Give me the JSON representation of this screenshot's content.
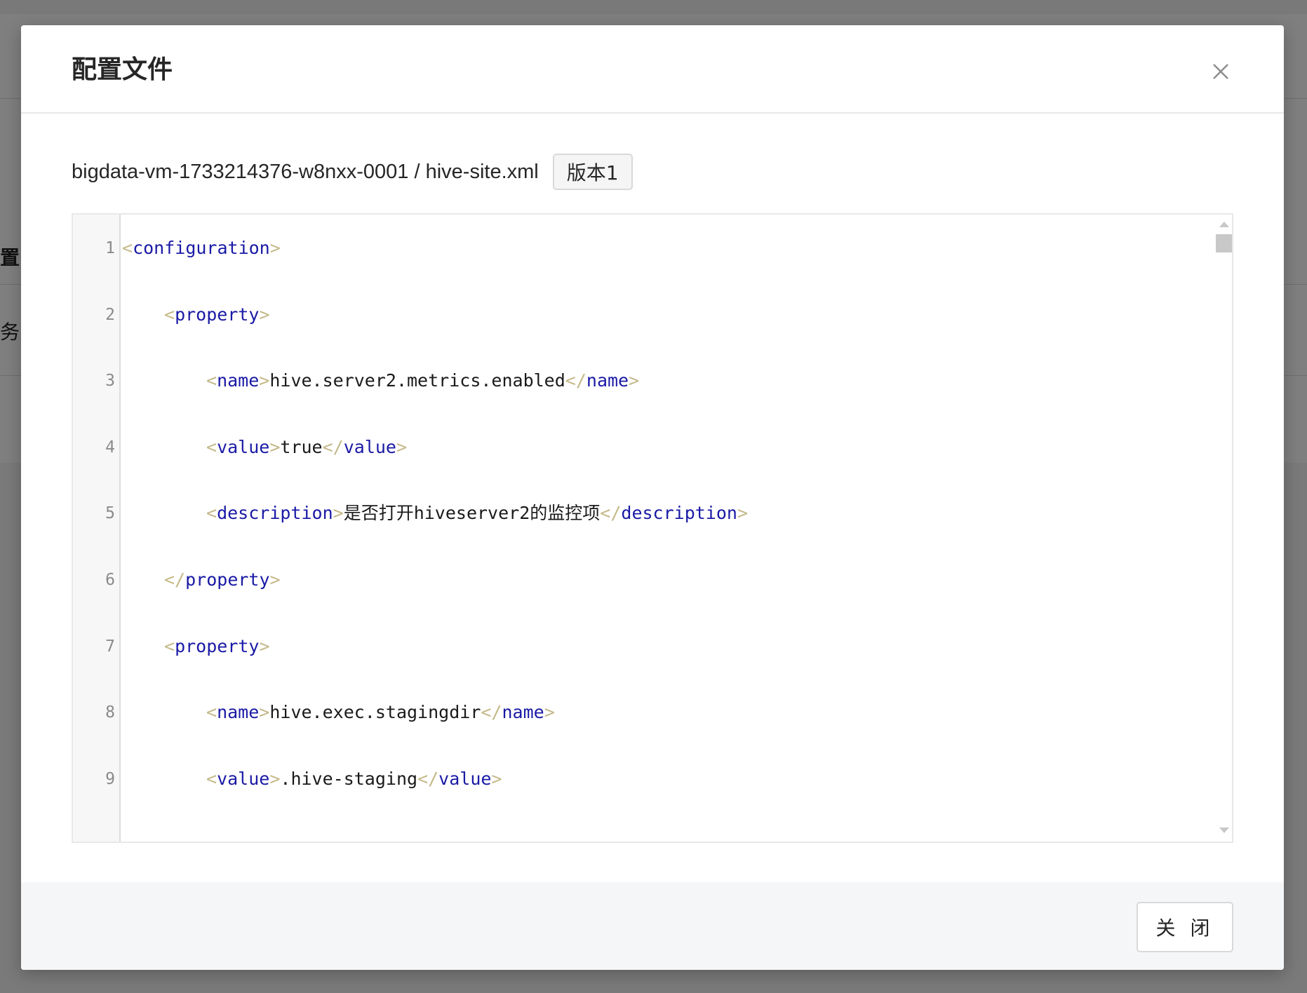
{
  "background": {
    "row1_text": "置",
    "row2_text": "务i"
  },
  "modal": {
    "title": "配置文件",
    "close_icon": "close-icon",
    "file_path": "bigdata-vm-1733214376-w8nxx-0001 / hive-site.xml",
    "version_label": "版本1",
    "footer_button_label": "关 闭"
  },
  "editor": {
    "lines": [
      {
        "number": "1",
        "open": "configuration",
        "text": "",
        "close": ""
      },
      {
        "number": "2",
        "open": "property",
        "text": "",
        "close": ""
      },
      {
        "number": "3",
        "open": "name",
        "text": "hive.server2.metrics.enabled",
        "close": "name"
      },
      {
        "number": "4",
        "open": "value",
        "text": "true",
        "close": "value"
      },
      {
        "number": "5",
        "open": "description",
        "text": "是否打开hiveserver2的监控项",
        "close": "description"
      },
      {
        "number": "6",
        "open": "",
        "text": "",
        "close": "property"
      },
      {
        "number": "7",
        "open": "property",
        "text": "",
        "close": ""
      },
      {
        "number": "8",
        "open": "name",
        "text": "hive.exec.stagingdir",
        "close": "name"
      },
      {
        "number": "9",
        "open": "value",
        "text": ".hive-staging",
        "close": "value"
      }
    ]
  }
}
